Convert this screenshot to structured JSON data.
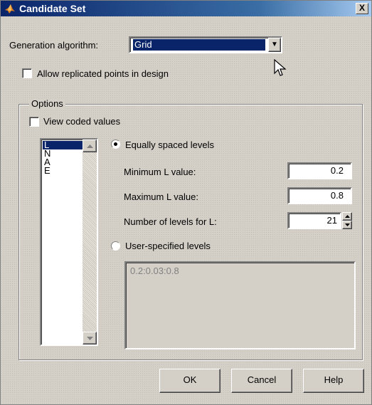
{
  "window": {
    "title": "Candidate Set",
    "close_glyph": "X"
  },
  "generation": {
    "label": "Generation algorithm:",
    "selected": "Grid",
    "dropdown_arrow": "▼"
  },
  "allow_replicated": {
    "label": "Allow replicated points in design",
    "checked": false
  },
  "options": {
    "legend": "Options",
    "view_coded": {
      "label": "View coded values",
      "checked": false
    },
    "variables": [
      "L",
      "N",
      "A",
      "E"
    ],
    "selected_variable": "L",
    "equally_spaced": {
      "label": "Equally spaced levels",
      "selected": true,
      "min_label": "Minimum L value:",
      "min_value": "0.2",
      "max_label": "Maximum L value:",
      "max_value": "0.8",
      "levels_label": "Number of levels for L:",
      "levels_value": "21"
    },
    "user_specified": {
      "label": "User-specified levels",
      "selected": false,
      "value": "0.2:0.03:0.8"
    }
  },
  "buttons": {
    "ok": "OK",
    "cancel": "Cancel",
    "help": "Help"
  },
  "icons": {
    "title_icon": "matlab-logo-icon",
    "cursor": "mouse-pointer-icon"
  }
}
